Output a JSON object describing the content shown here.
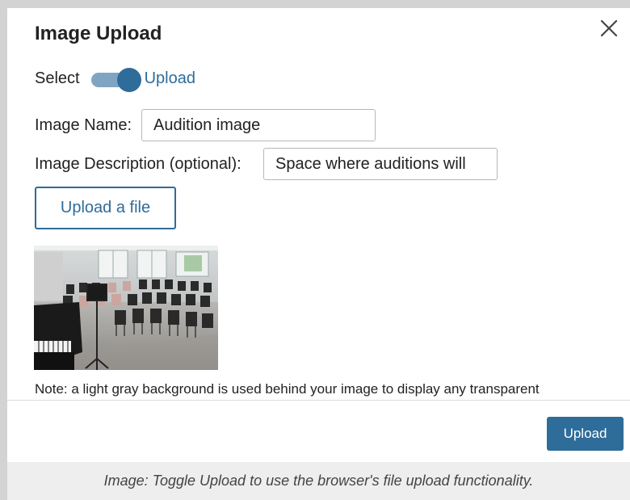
{
  "dialog": {
    "title": "Image Upload",
    "close_icon": "close-icon"
  },
  "toggle": {
    "left_label": "Select",
    "right_label": "Upload",
    "state": "Upload",
    "accent_color": "#2e6c9a"
  },
  "form": {
    "name_label": "Image Name:",
    "name_value": "Audition image",
    "description_label": "Image Description (optional):",
    "description_value": "Space where auditions will"
  },
  "upload_file_label": "Upload a file",
  "preview": {
    "icon": "image-preview"
  },
  "note": "Note: a light gray background is used behind your image to display any transparent",
  "footer": {
    "upload_label": "Upload"
  },
  "caption": "Image: Toggle Upload to use the browser's file upload functionality."
}
